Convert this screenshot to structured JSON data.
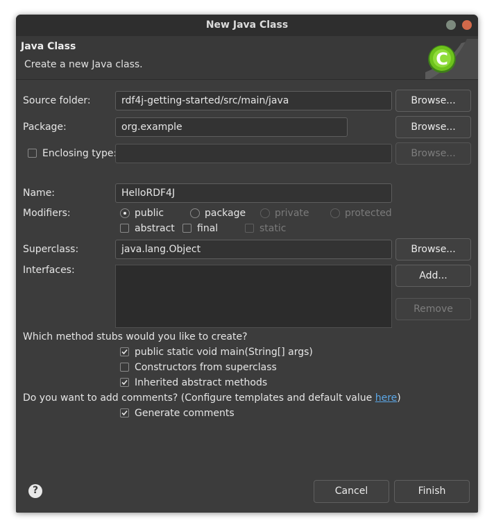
{
  "window": {
    "title": "New Java Class"
  },
  "header": {
    "title": "Java Class",
    "subtitle": "Create a new Java class.",
    "logo_letter": "C"
  },
  "source_folder": {
    "label": "Source folder:",
    "value": "rdf4j-getting-started/src/main/java",
    "browse": "Browse..."
  },
  "package": {
    "label": "Package:",
    "value": "org.example",
    "browse": "Browse..."
  },
  "enclosing": {
    "label": "Enclosing type:",
    "value": "",
    "browse": "Browse...",
    "checked": false
  },
  "name": {
    "label": "Name:",
    "value": "HelloRDF4J"
  },
  "modifiers": {
    "label": "Modifiers:",
    "public": "public",
    "package": "package",
    "private": "private",
    "protected": "protected",
    "selected": "public",
    "abstract": "abstract",
    "final": "final",
    "static": "static"
  },
  "superclass": {
    "label": "Superclass:",
    "value": "java.lang.Object",
    "browse": "Browse..."
  },
  "interfaces": {
    "label": "Interfaces:",
    "add": "Add...",
    "remove": "Remove",
    "items": []
  },
  "stubs": {
    "question": "Which method stubs would you like to create?",
    "main": {
      "label": "public static void main(String[] args)",
      "checked": true
    },
    "constructors": {
      "label": "Constructors from superclass",
      "checked": false
    },
    "inherited": {
      "label": "Inherited abstract methods",
      "checked": true
    }
  },
  "comments": {
    "question_prefix": "Do you want to add comments? (Configure templates and default value ",
    "link": "here",
    "question_suffix": ")",
    "generate": {
      "label": "Generate comments",
      "checked": true
    }
  },
  "footer": {
    "help": "?",
    "cancel": "Cancel",
    "finish": "Finish"
  },
  "colors": {
    "window_bg": "#3c3c3c",
    "link": "#5ca8e8",
    "close_button": "#d2694a",
    "minimize_button": "#7d8a7e",
    "logo_green": "#6ec21c"
  }
}
